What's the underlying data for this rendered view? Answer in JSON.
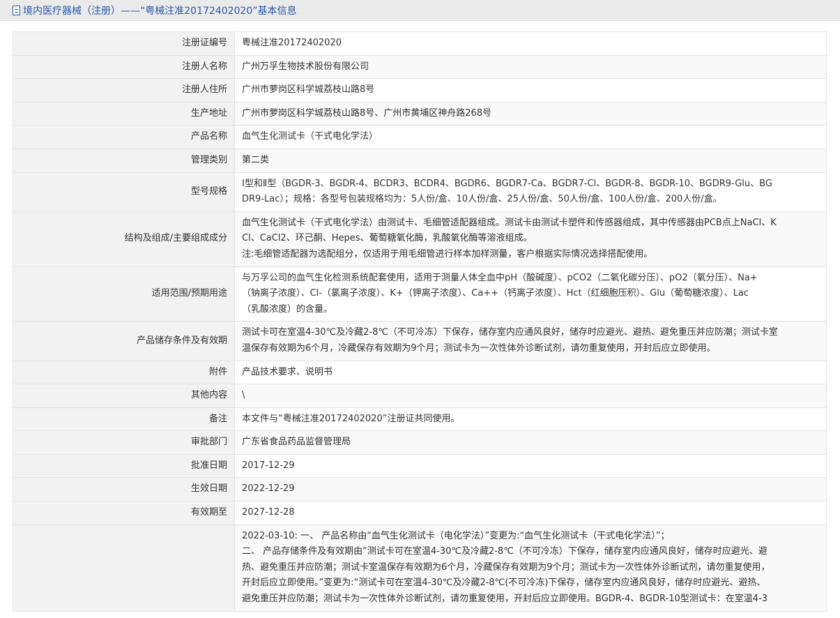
{
  "header": {
    "title": "境内医疗器械（注册）——“粤械注准20172402020”基本信息"
  },
  "rows": [
    {
      "label": "注册证编号",
      "value": [
        "粤械注准20172402020"
      ]
    },
    {
      "label": "注册人名称",
      "value": [
        "广州万孚生物技术股份有限公司"
      ]
    },
    {
      "label": "注册人住所",
      "value": [
        "广州市萝岗区科学城荔枝山路8号"
      ]
    },
    {
      "label": "生产地址",
      "value": [
        "广州市萝岗区科学城荔枝山路8号、广州市黄埔区神舟路268号"
      ]
    },
    {
      "label": "产品名称",
      "value": [
        "血气生化测试卡（干式电化学法）"
      ]
    },
    {
      "label": "管理类别",
      "value": [
        "第二类"
      ]
    },
    {
      "label": "型号规格",
      "value": [
        "Ⅰ型和Ⅱ型（BGDR-3、BGDR-4、BCDR3、BCDR4、BGDR6、BGDR7-Ca、BGDR7-Cl、BGDR-8、BGDR-10、BGDR9-Glu、BG",
        "DR9-Lac）；规格：各型号包装规格均为：5人份/盒、10人份/盒、25人份/盒、50人份/盒、100人份/盒、200人份/盒。"
      ]
    },
    {
      "label": "结构及组成/主要组成成分",
      "value": [
        "血气生化测试卡（干式电化学法）由测试卡、毛细管适配器组成。测试卡由测试卡塑件和传感器组成，其中传感器由PCB点上NaCl、K",
        "Cl、CaCl2、环己酮、Hepes、葡萄糖氧化酶，乳酸氧化酶等溶液组成。",
        "注:毛细管适配器为选配组分，仅适用于用毛细管进行样本加样测量，客户根据实际情况选择搭配使用。"
      ]
    },
    {
      "label": "适用范围/预期用途",
      "value": [
        "与万孚公司的血气生化检测系统配套使用，适用于测量人体全血中pH（酸碱度）、pCO2（二氧化碳分压）、pO2（氧分压）、Na+",
        "（钠离子浓度）、Cl-（氯离子浓度）、K+（钾离子浓度）、Ca++（钙离子浓度）、Hct（红细胞压积）、Glu（葡萄糖浓度）、Lac",
        "（乳酸浓度）的含量。"
      ]
    },
    {
      "label": "产品储存条件及有效期",
      "value": [
        "测试卡可在室温4-30℃及冷藏2-8℃（不可冷冻）下保存，储存室内应通风良好，储存时应避光、避热、避免重压并应防潮；测试卡室",
        "温保存有效期为6个月，冷藏保存有效期为9个月；测试卡为一次性体外诊断试剂，请勿重复使用，开封后应立即使用。"
      ]
    },
    {
      "label": "附件",
      "value": [
        "产品技术要求、说明书"
      ]
    },
    {
      "label": "其他内容",
      "value": [
        "\\"
      ]
    },
    {
      "label": "备注",
      "value": [
        "本文件与“粤械注准20172402020”注册证共同使用。"
      ]
    },
    {
      "label": "审批部门",
      "value": [
        "广东省食品药品监督管理局"
      ]
    },
    {
      "label": "批准日期",
      "value": [
        "2017-12-29"
      ]
    },
    {
      "label": "生效日期",
      "value": [
        "2022-12-29"
      ]
    },
    {
      "label": "有效期至",
      "value": [
        "2027-12-28"
      ]
    },
    {
      "label": "",
      "value": [
        "2022-03-10: 一、 产品名称由“血气生化测试卡（电化学法）”变更为:“血气生化测试卡（干式电化学法）”；",
        "二、 产品存储条件及有效期由“测试卡可在室温4-30℃及冷藏2-8℃（不可冷冻）下保存，储存室内应通风良好，储存时应避光、避",
        "热、避免重压并应防潮；测试卡室温保存有效期为6个月，冷藏保存有效期为9个月；测试卡为一次性体外诊断试剂，请勿重复使用，",
        "开封后应立即使用。”变更为:“测试卡可在室温4-30℃及冷藏2-8℃(不可冷冻)下保存，储存室内应通风良好，储存时应避光、避热、",
        "避免重压并应防潮；测试卡为一次性体外诊断试剂，请勿重复使用，开封后应立即使用。BGDR-4、BGDR-10型测试卡：在室温4-3"
      ]
    }
  ]
}
